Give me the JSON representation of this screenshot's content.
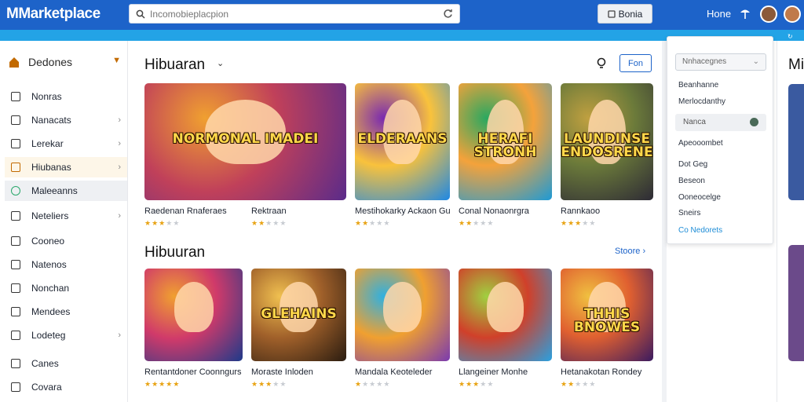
{
  "header": {
    "logo": "MMarketplace",
    "search_placeholder": "Incomobieplacpion",
    "search_button": "Bonia",
    "nav_home": "Hone"
  },
  "sidebar": {
    "header_label": "Dedones",
    "items": [
      {
        "label": "Nonras",
        "chevron": false
      },
      {
        "label": "Nanacats",
        "chevron": true
      },
      {
        "label": "Lerekar",
        "chevron": true
      },
      {
        "label": "Hiubanas",
        "chevron": true,
        "active": true
      },
      {
        "label": "Maleeanns",
        "chevron": false,
        "hover": true
      },
      {
        "label": "Neteliers",
        "chevron": true
      },
      {
        "label": "Cooneo",
        "chevron": false
      },
      {
        "label": "Natenos",
        "chevron": false
      },
      {
        "label": "Nonchan",
        "chevron": false
      },
      {
        "label": "Mendees",
        "chevron": false
      },
      {
        "label": "Lodeteg",
        "chevron": true
      },
      {
        "label": "Canes",
        "chevron": false
      },
      {
        "label": "Covara",
        "chevron": false
      }
    ]
  },
  "section1": {
    "title": "Hibuaran",
    "filter_button": "Fon",
    "cards": [
      {
        "title": "Raedenan Rnaferaes",
        "art_text": "NORMONAL IMADEI",
        "rating": 3
      },
      {
        "title": "Rektraan",
        "art_text": "",
        "rating": 2
      },
      {
        "title": "Mestihokarky Ackaon Guiadoly",
        "art_text": "ELDERAANS",
        "rating": 2
      },
      {
        "title": "Conal Nonaonrgra",
        "art_text": "HERAFI STRONH",
        "rating": 2
      },
      {
        "title": "Rannkaoo",
        "art_text": "LAUNDINSE ENDOSRENE",
        "rating": 3
      }
    ]
  },
  "section2": {
    "title": "Hibuuran",
    "link": "Stoore",
    "cards": [
      {
        "title": "Rentantdoner Coonngurs",
        "art_text": "",
        "rating": 5
      },
      {
        "title": "Moraste Inloden",
        "art_text": "GLEHAINS",
        "rating": 3
      },
      {
        "title": "Mandala Keoteleder",
        "art_text": "",
        "rating": 1
      },
      {
        "title": "Llangeiner Monhe",
        "art_text": "",
        "rating": 3
      },
      {
        "title": "Hetanakotan Rondey",
        "art_text": "THHIS BNOWES",
        "rating": 2
      }
    ]
  },
  "panel": {
    "select_value": "Nnhacegnes",
    "items": [
      "Beanhanne",
      "Merlocdanthy",
      "Apeooombet",
      "Dot Geg",
      "Beseon",
      "Ooneocelge",
      "Sneirs"
    ],
    "highlight": "Nanca",
    "footer_link": "Co Nedorets"
  },
  "right_strip": {
    "title": "Mi"
  }
}
